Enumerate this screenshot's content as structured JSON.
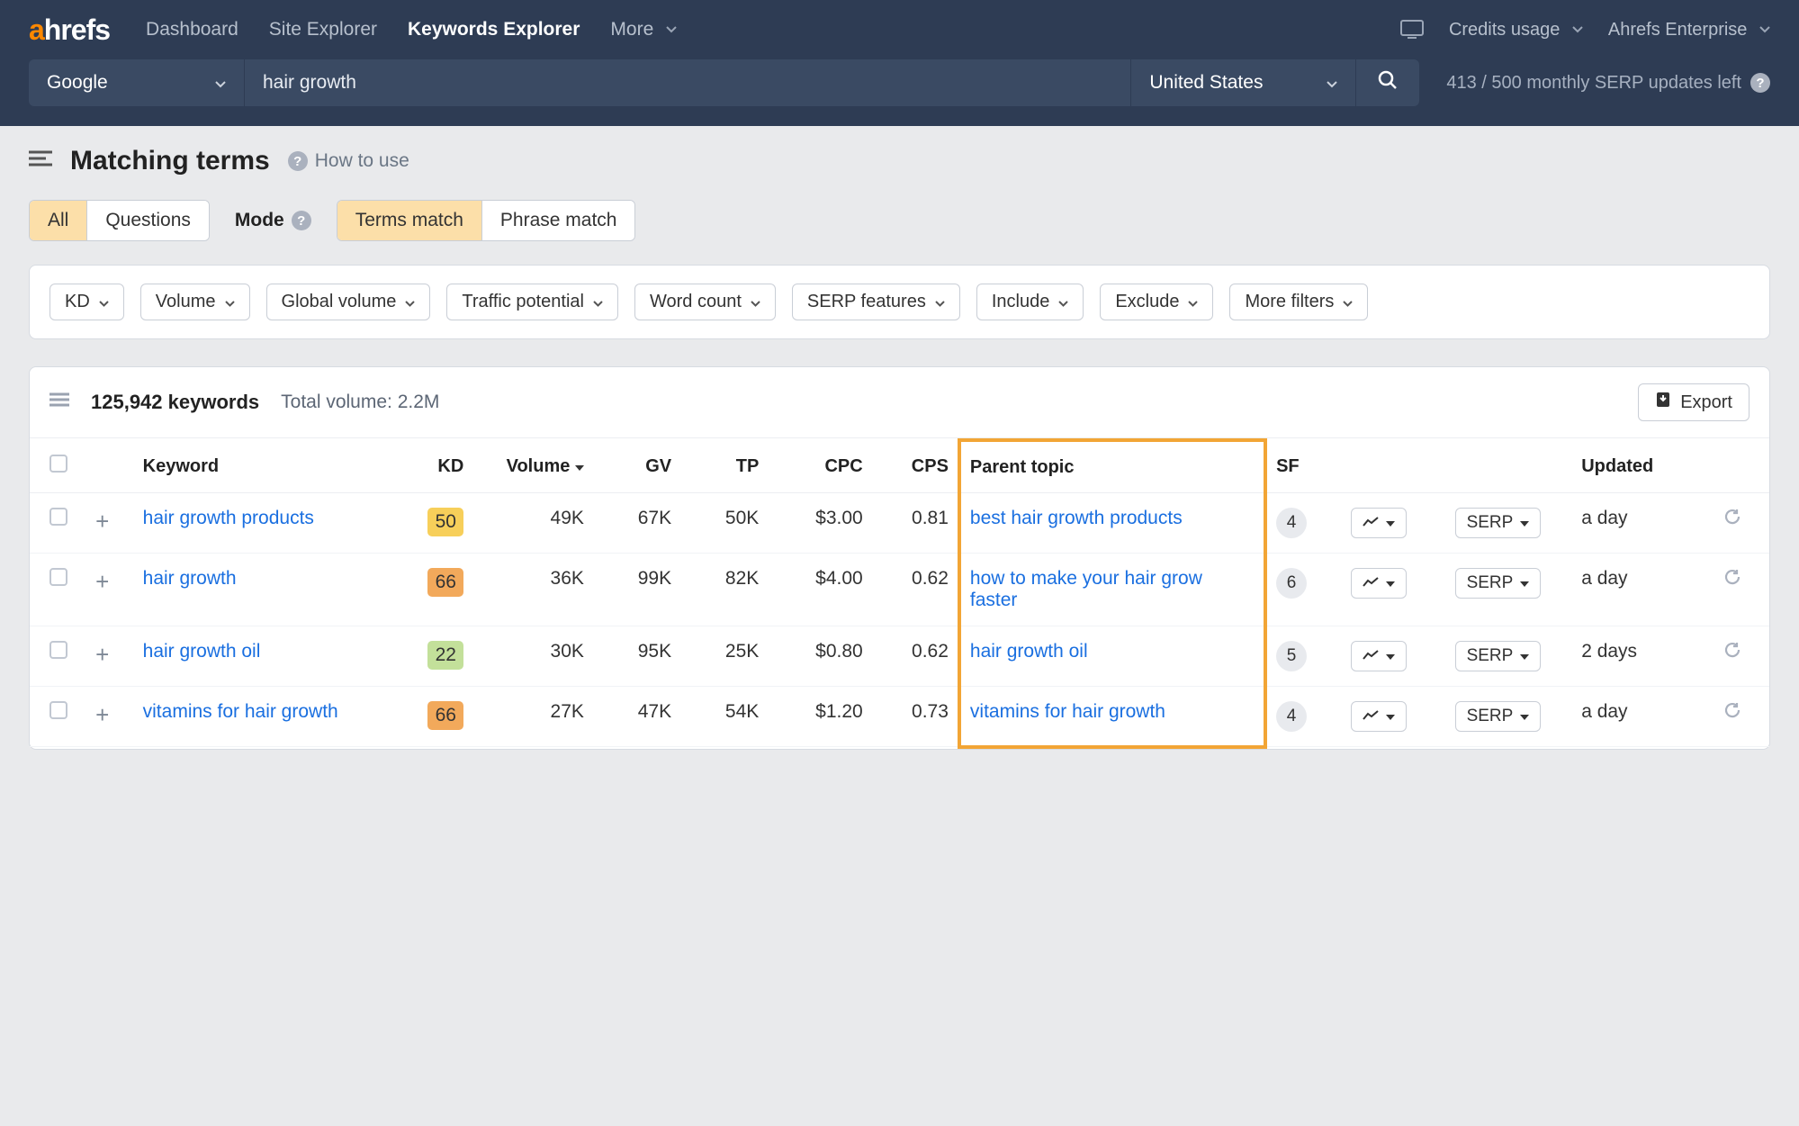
{
  "brand": {
    "prefix": "a",
    "rest": "hrefs"
  },
  "nav": {
    "items": [
      "Dashboard",
      "Site Explorer",
      "Keywords Explorer",
      "More"
    ],
    "active_index": 2,
    "credits": "Credits usage",
    "account": "Ahrefs Enterprise"
  },
  "search": {
    "engine": "Google",
    "query": "hair growth",
    "country": "United States",
    "serp_note": "413 / 500 monthly SERP updates left"
  },
  "page": {
    "title": "Matching terms",
    "howto": "How to use"
  },
  "tabs": {
    "scope": [
      "All",
      "Questions"
    ],
    "scope_active": 0,
    "mode_label": "Mode",
    "mode": [
      "Terms match",
      "Phrase match"
    ],
    "mode_active": 0
  },
  "filters": [
    "KD",
    "Volume",
    "Global volume",
    "Traffic potential",
    "Word count",
    "SERP features",
    "Include",
    "Exclude",
    "More filters"
  ],
  "summary": {
    "count": "125,942 keywords",
    "volume": "Total volume: 2.2M",
    "export": "Export"
  },
  "columns": {
    "keyword": "Keyword",
    "kd": "KD",
    "volume": "Volume",
    "gv": "GV",
    "tp": "TP",
    "cpc": "CPC",
    "cps": "CPS",
    "parent": "Parent topic",
    "sf": "SF",
    "updated": "Updated",
    "serp_btn": "SERP"
  },
  "rows": [
    {
      "keyword": "hair growth products",
      "kd": "50",
      "kd_class": "kd-50",
      "volume": "49K",
      "gv": "67K",
      "tp": "50K",
      "cpc": "$3.00",
      "cps": "0.81",
      "parent": "best hair growth products",
      "sf": "4",
      "updated": "a day"
    },
    {
      "keyword": "hair growth",
      "kd": "66",
      "kd_class": "kd-66",
      "volume": "36K",
      "gv": "99K",
      "tp": "82K",
      "cpc": "$4.00",
      "cps": "0.62",
      "parent": "how to make your hair grow faster",
      "sf": "6",
      "updated": "a day"
    },
    {
      "keyword": "hair growth oil",
      "kd": "22",
      "kd_class": "kd-22",
      "volume": "30K",
      "gv": "95K",
      "tp": "25K",
      "cpc": "$0.80",
      "cps": "0.62",
      "parent": "hair growth oil",
      "sf": "5",
      "updated": "2 days"
    },
    {
      "keyword": "vitamins for hair growth",
      "kd": "66",
      "kd_class": "kd-66",
      "volume": "27K",
      "gv": "47K",
      "tp": "54K",
      "cpc": "$1.20",
      "cps": "0.73",
      "parent": "vitamins for hair growth",
      "sf": "4",
      "updated": "a day"
    }
  ]
}
